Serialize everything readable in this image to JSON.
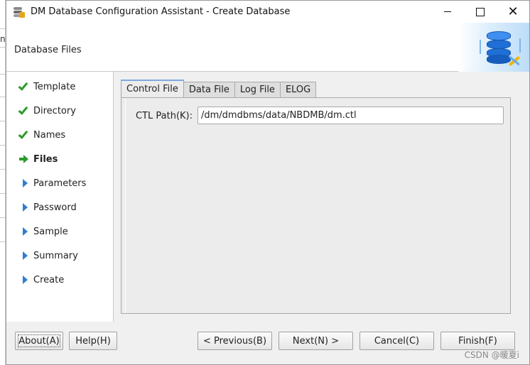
{
  "window": {
    "title": "DM Database Configuration Assistant - Create Database",
    "controls": {
      "minimize": "",
      "maximize": "",
      "close": "✕"
    }
  },
  "background_window": {
    "glyph": "n"
  },
  "header": {
    "title": "Database Files",
    "icon": "database-config-icon"
  },
  "steps": [
    {
      "label": "Template",
      "state": "done",
      "icon": "check-icon"
    },
    {
      "label": "Directory",
      "state": "done",
      "icon": "check-icon"
    },
    {
      "label": "Names",
      "state": "done",
      "icon": "check-icon"
    },
    {
      "label": "Files",
      "state": "current",
      "icon": "arrow-right-icon"
    },
    {
      "label": "Parameters",
      "state": "pending",
      "icon": "triangle-right-icon"
    },
    {
      "label": "Password",
      "state": "pending",
      "icon": "triangle-right-icon"
    },
    {
      "label": "Sample",
      "state": "pending",
      "icon": "triangle-right-icon"
    },
    {
      "label": "Summary",
      "state": "pending",
      "icon": "triangle-right-icon"
    },
    {
      "label": "Create",
      "state": "pending",
      "icon": "triangle-right-icon"
    }
  ],
  "tabs": [
    {
      "label": "Control File",
      "active": true
    },
    {
      "label": "Data File",
      "active": false
    },
    {
      "label": "Log File",
      "active": false
    },
    {
      "label": "ELOG",
      "active": false
    }
  ],
  "control_file": {
    "ctl_path_label": "CTL Path(K):",
    "ctl_path_value": "/dm/dmdbms/data/NBDMB/dm.ctl"
  },
  "buttons": {
    "about": "About(A)",
    "help": "Help(H)",
    "previous": "< Previous(B)",
    "next": "Next(N) >",
    "cancel": "Cancel(C)",
    "finish": "Finish(F)"
  },
  "watermark": "CSDN @暖夏i",
  "colors": {
    "done": "#2c9a2c",
    "pending": "#2d7fd3",
    "tab_active_accent": "#7ea9dc"
  }
}
